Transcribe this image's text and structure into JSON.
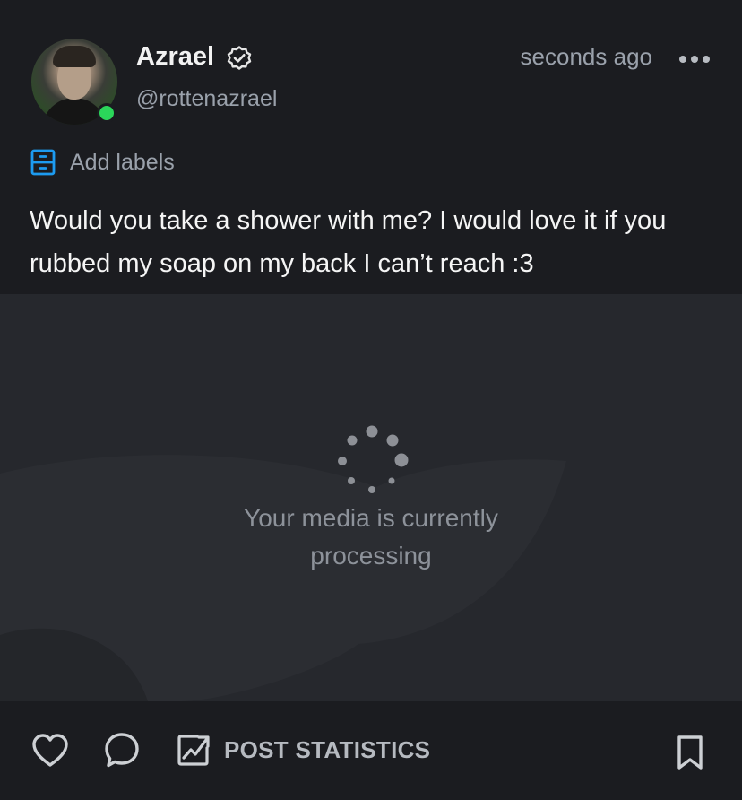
{
  "post": {
    "author": {
      "display_name": "Azrael",
      "handle": "@rottenazrael",
      "verified": true,
      "online": true
    },
    "timestamp": "seconds ago",
    "labels_action": "Add labels",
    "text": "Would you take a shower with me? I would love it if you rubbed my soap on my back I can’t reach :3",
    "media": {
      "status_text": "Your media is currently processing"
    },
    "actions": {
      "post_statistics_label": "POST STATISTICS"
    }
  },
  "icons": {
    "verified": "verified-badge-icon",
    "more": "more-options-icon",
    "labels": "label-drawer-icon",
    "spinner": "loading-spinner-icon",
    "like": "heart-icon",
    "reply": "speech-bubble-icon",
    "stats": "chart-icon",
    "bookmark": "bookmark-icon"
  },
  "colors": {
    "background": "#1b1c20",
    "media_background": "#26282d",
    "online": "#2bd65a",
    "label_accent": "#1d9bf0",
    "muted_text": "#9aa1ab"
  }
}
